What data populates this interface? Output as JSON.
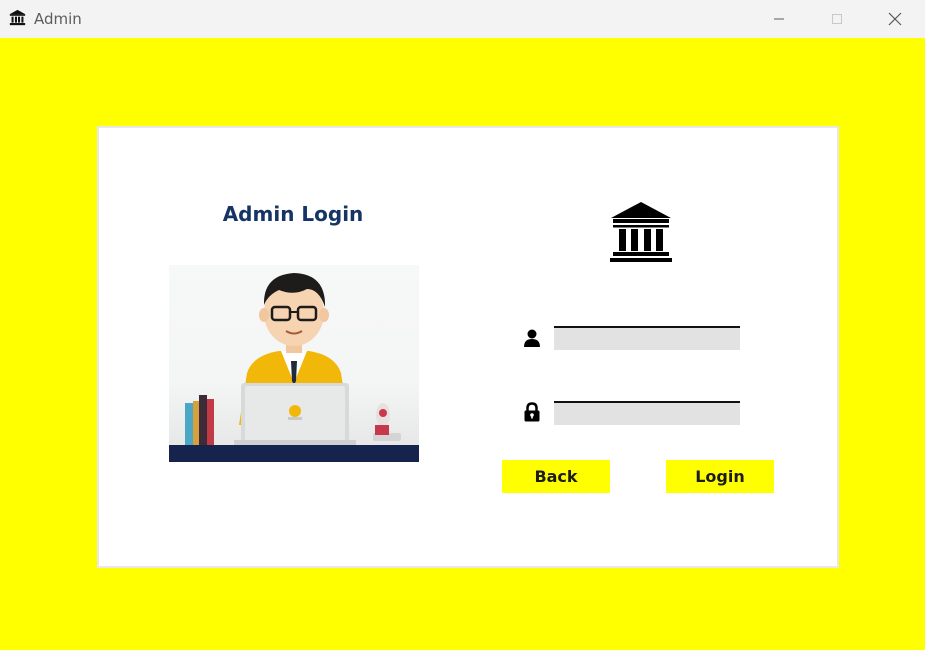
{
  "window": {
    "title": "Admin",
    "app_icon": "bank-icon",
    "controls": [
      "minimize",
      "maximize",
      "close"
    ]
  },
  "colors": {
    "background": "#ffff00",
    "card": "#ffffff",
    "heading": "#163565",
    "button": "#ffff00",
    "field": "#e2e2e2"
  },
  "login": {
    "heading": "Admin Login",
    "illustration": "admin-at-laptop-illustration",
    "logo": "bank-icon",
    "username": {
      "icon": "user-icon",
      "value": "",
      "placeholder": ""
    },
    "password": {
      "icon": "lock-icon",
      "value": "",
      "placeholder": ""
    },
    "back_label": "Back",
    "login_label": "Login"
  }
}
